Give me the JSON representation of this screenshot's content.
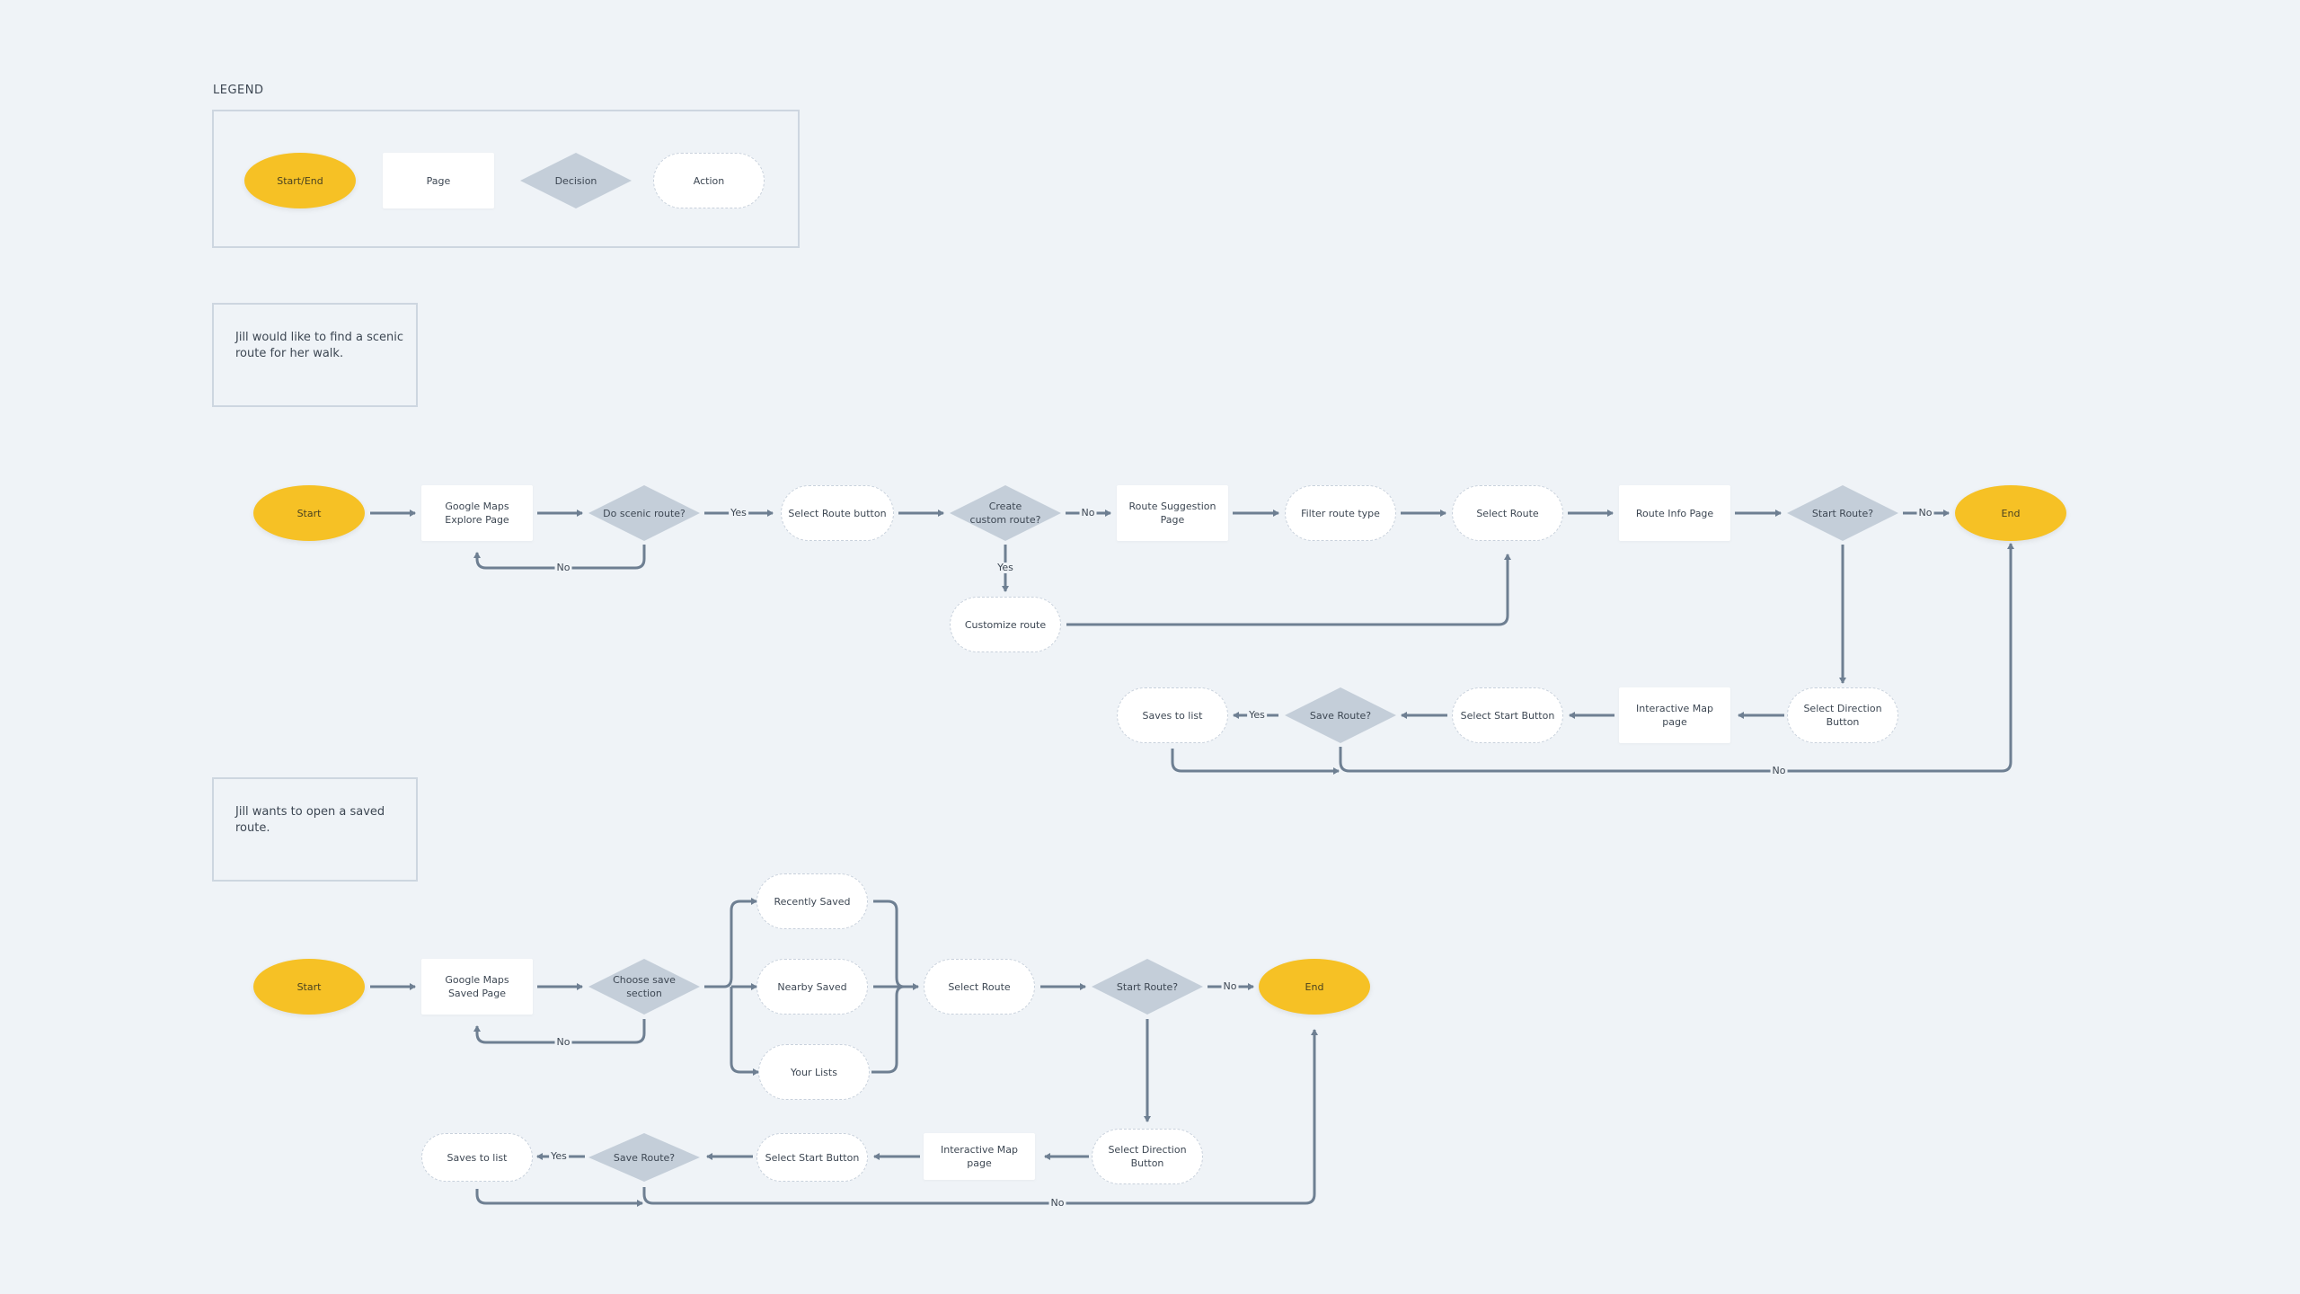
{
  "legend": {
    "title": "LEGEND",
    "items": [
      {
        "shape": "start-end",
        "label": "Start/End"
      },
      {
        "shape": "page",
        "label": "Page"
      },
      {
        "shape": "decision",
        "label": "Decision"
      },
      {
        "shape": "action",
        "label": "Action"
      }
    ]
  },
  "colors": {
    "background": "#eff3f7",
    "start_end": "#f6c125",
    "page": "#ffffff",
    "decision": "#c4ced9",
    "action_border": "#c8d1dc",
    "connector": "#6e7f92",
    "text": "#3d4753"
  },
  "scenario1": {
    "note": "Jill would like to find a scenic route for her walk.",
    "nodes": {
      "start": "Start",
      "explore_page": "Google Maps Explore Page",
      "do_scenic": "Do scenic route?",
      "select_route_button": "Select Route button",
      "create_custom": "Create custom route?",
      "route_suggestion": "Route Suggestion Page",
      "filter_route": "Filter route type",
      "select_route": "Select Route",
      "route_info": "Route Info Page",
      "start_route": "Start Route?",
      "end": "End",
      "customize_route": "Customize route",
      "select_direction": "Select Direction Button",
      "interactive_map": "Interactive Map page",
      "select_start": "Select Start Button",
      "save_route": "Save Route?",
      "saves_to_list": "Saves to list"
    },
    "edge_labels": {
      "scenic_yes": "Yes",
      "scenic_no": "No",
      "custom_no": "No",
      "custom_yes": "Yes",
      "start_no": "No",
      "save_yes": "Yes",
      "save_no": "No"
    }
  },
  "scenario2": {
    "note": "Jill wants to open a saved route.",
    "nodes": {
      "start": "Start",
      "saved_page": "Google Maps Saved Page",
      "choose_section": "Choose save section",
      "recently_saved": "Recently Saved",
      "nearby_saved": "Nearby Saved",
      "your_lists": "Your Lists",
      "select_route": "Select Route",
      "start_route": "Start Route?",
      "end": "End",
      "select_direction": "Select Direction Button",
      "interactive_map": "Interactive Map page",
      "select_start": "Select Start Button",
      "save_route": "Save Route?",
      "saves_to_list": "Saves to list"
    },
    "edge_labels": {
      "choose_no": "No",
      "start_no": "No",
      "save_yes": "Yes",
      "save_no": "No"
    }
  }
}
